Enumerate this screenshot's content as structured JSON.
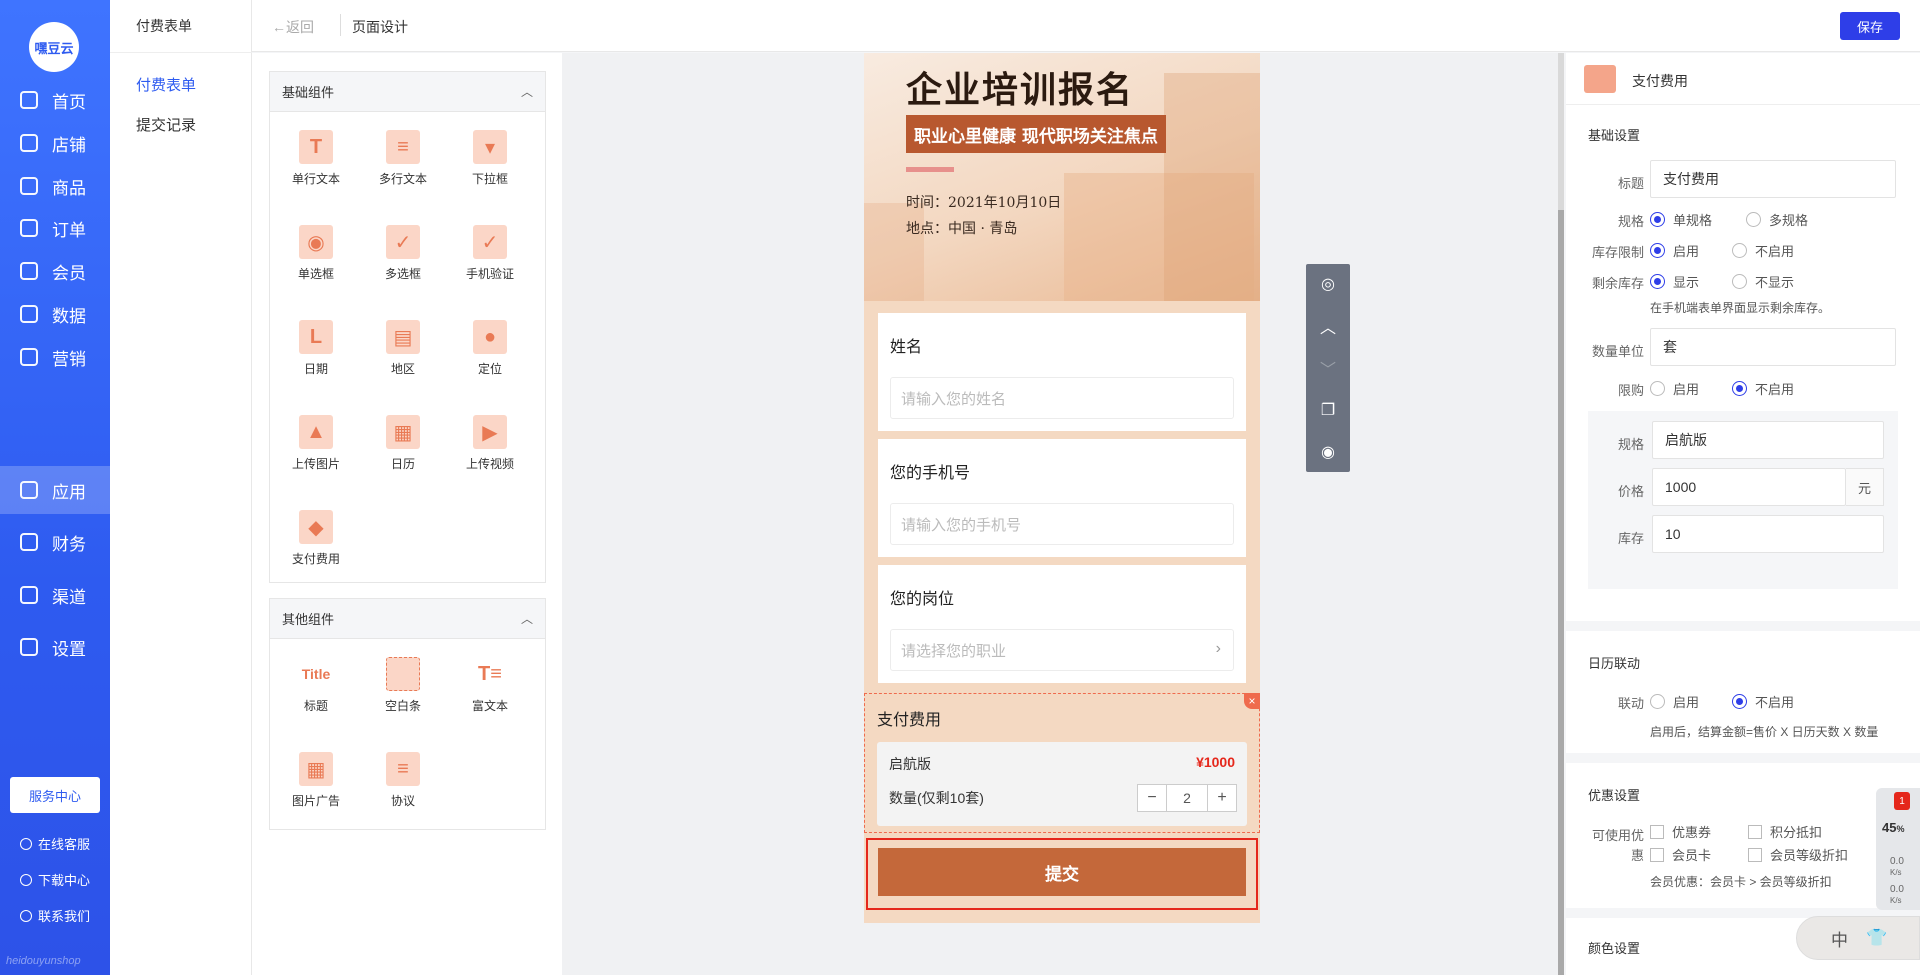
{
  "nav": {
    "logo": "嘿豆云",
    "items": [
      "首页",
      "店铺",
      "商品",
      "订单",
      "会员",
      "数据",
      "营销",
      "应用",
      "财务",
      "渠道",
      "设置"
    ],
    "active": "应用",
    "service_center": "服务中心",
    "links": [
      "在线客服",
      "下载中心",
      "联系我们"
    ],
    "brand_text": "heidouyunshop"
  },
  "subnav": {
    "title": "付费表单",
    "items": [
      "付费表单",
      "提交记录"
    ]
  },
  "topbar": {
    "back": "←返回",
    "title": "页面设计",
    "save": "保存"
  },
  "components": {
    "basic": {
      "title": "基础组件",
      "items": [
        {
          "label": "单行文本",
          "icon": "text-icon"
        },
        {
          "label": "多行文本",
          "icon": "multiline-icon"
        },
        {
          "label": "下拉框",
          "icon": "dropdown-icon"
        },
        {
          "label": "单选框",
          "icon": "radio-icon"
        },
        {
          "label": "多选框",
          "icon": "checkbox-icon"
        },
        {
          "label": "手机验证",
          "icon": "phone-icon"
        },
        {
          "label": "日期",
          "icon": "date-icon"
        },
        {
          "label": "地区",
          "icon": "region-icon"
        },
        {
          "label": "定位",
          "icon": "location-icon"
        },
        {
          "label": "上传图片",
          "icon": "image-icon"
        },
        {
          "label": "日历",
          "icon": "calendar-icon"
        },
        {
          "label": "上传视频",
          "icon": "video-icon"
        },
        {
          "label": "支付费用",
          "icon": "payment-icon"
        }
      ]
    },
    "other": {
      "title": "其他组件",
      "items": [
        {
          "label": "标题",
          "icon": "title-icon",
          "glyph": "Title"
        },
        {
          "label": "空白条",
          "icon": "blank-icon"
        },
        {
          "label": "富文本",
          "icon": "richtext-icon"
        },
        {
          "label": "图片广告",
          "icon": "image-ad-icon"
        },
        {
          "label": "协议",
          "icon": "agreement-icon"
        }
      ]
    }
  },
  "preview": {
    "banner": {
      "title": "企业培训报名",
      "subtitle": "职业心里健康 现代职场关注焦点",
      "time": "时间：2021年10月10日",
      "place": "地点：中国 · 青岛"
    },
    "fields": [
      {
        "label": "姓名",
        "placeholder": "请输入您的姓名"
      },
      {
        "label": "您的手机号",
        "placeholder": "请输入您的手机号"
      },
      {
        "label": "您的岗位",
        "placeholder": "请选择您的职业"
      }
    ],
    "payment": {
      "title": "支付费用",
      "spec": "启航版",
      "price": "¥1000",
      "qty_label": "数量(仅剩10套)",
      "minus": "−",
      "qty": "2",
      "plus": "+"
    },
    "submit": "提交"
  },
  "tools": [
    "eye-icon",
    "arrow-up-icon",
    "arrow-down-icon",
    "copy-icon",
    "settings-icon"
  ],
  "settings": {
    "header": "支付费用",
    "basic_title": "基础设置",
    "title_label": "标题",
    "title_value": "支付费用",
    "spec_label": "规格",
    "spec_opts": [
      "单规格",
      "多规格"
    ],
    "stock_limit_label": "库存限制",
    "stock_limit_opts": [
      "启用",
      "不启用"
    ],
    "remain_label": "剩余库存",
    "remain_opts": [
      "显示",
      "不显示"
    ],
    "remain_hint": "在手机端表单界面显示剩余库存。",
    "unit_label": "数量单位",
    "unit_value": "套",
    "limit_label": "限购",
    "limit_opts": [
      "启用",
      "不启用"
    ],
    "spec_name_label": "规格",
    "spec_name_value": "启航版",
    "price_label": "价格",
    "price_value": "1000",
    "price_unit": "元",
    "stock_label": "库存",
    "stock_value": "10",
    "calendar_title": "日历联动",
    "link_label": "联动",
    "link_opts": [
      "启用",
      "不启用"
    ],
    "link_hint": "启用后，结算金额=售价 X 日历天数 X 数量",
    "discount_title": "优惠设置",
    "discount_label_1": "可使用优",
    "discount_label_2": "惠",
    "discount_opts": [
      "优惠券",
      "积分抵扣",
      "会员卡",
      "会员等级折扣"
    ],
    "discount_hint": "会员优惠：会员卡 > 会员等级折扣",
    "color_title": "颜色设置"
  },
  "widget": {
    "badge": "1",
    "percent": "45",
    "percent_unit": "%",
    "up": "0.0",
    "down": "0.0",
    "unit": "K/s"
  },
  "ime": {
    "lang": "中"
  }
}
